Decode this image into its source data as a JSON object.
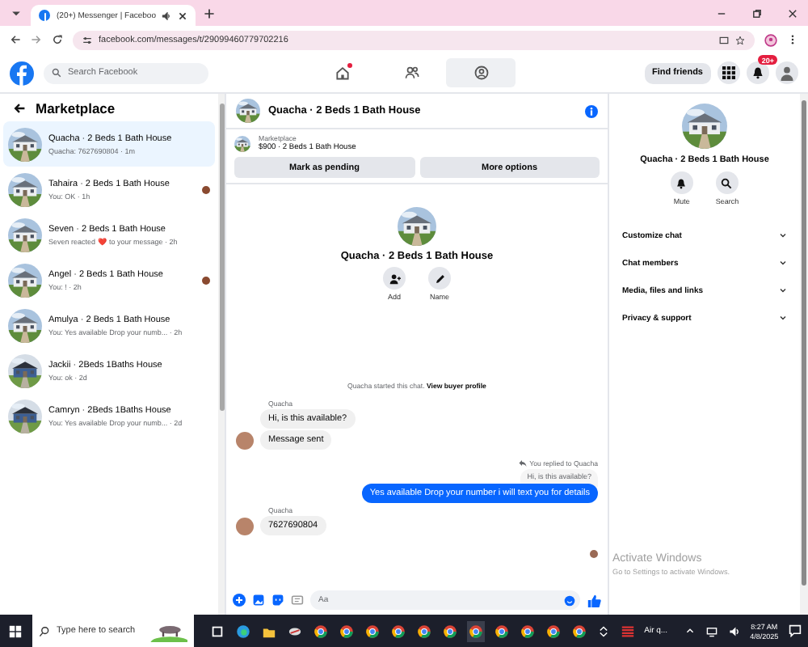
{
  "browser": {
    "tab_title": "(20+) Messenger | Faceboo",
    "url": "facebook.com/messages/t/29099460779702216"
  },
  "header": {
    "search_placeholder": "Search Facebook",
    "nav": [
      {
        "kind": "home",
        "selected": false,
        "notified": true
      },
      {
        "kind": "people",
        "selected": false,
        "notified": false
      },
      {
        "kind": "marketplace",
        "selected": true,
        "notified": false
      }
    ],
    "find_friends": "Find friends",
    "notification_count": "20+"
  },
  "sidebar": {
    "title": "Marketplace",
    "conversations": [
      {
        "name": "Quacha · 2 Beds 1 Bath House",
        "preview": "Quacha: 7627690804 · 1m",
        "selected": true,
        "seen": false,
        "kind": "white_house"
      },
      {
        "name": "Tahaira · 2 Beds 1 Bath House",
        "preview": "You: OK · 1h",
        "selected": false,
        "seen": true,
        "kind": "white_house"
      },
      {
        "name": "Seven · 2 Beds 1 Bath House",
        "preview": "Seven reacted ❤️ to your message · 2h",
        "selected": false,
        "seen": false,
        "kind": "white_house"
      },
      {
        "name": "Angel · 2 Beds 1 Bath House",
        "preview": "You: ! · 2h",
        "selected": false,
        "seen": true,
        "kind": "white_house"
      },
      {
        "name": "Amulya · 2 Beds 1 Bath House",
        "preview": "You: Yes available Drop your numb... · 2h",
        "selected": false,
        "seen": false,
        "kind": "white_house"
      },
      {
        "name": "Jackii · 2Beds 1Baths House",
        "preview": "You: ok · 2d",
        "selected": false,
        "seen": false,
        "kind": "blue_house"
      },
      {
        "name": "Camryn · 2Beds 1Baths House",
        "preview": "You: Yes available Drop your numb... · 2d",
        "selected": false,
        "seen": false,
        "kind": "blue_house"
      }
    ]
  },
  "chat": {
    "title": "Quacha · 2 Beds 1 Bath House",
    "listing": {
      "label": "Marketplace",
      "title": "$900 · 2 Beds 1 Bath House",
      "buttons": [
        "Mark as pending",
        "More options"
      ]
    },
    "intro": {
      "title": "Quacha · 2 Beds 1 Bath House",
      "actions": [
        {
          "kind": "add",
          "label": "Add"
        },
        {
          "kind": "name",
          "label": "Name"
        }
      ]
    },
    "notice": {
      "text": "Quacha started this chat.",
      "link": "View buyer profile"
    },
    "messages": [
      {
        "kind": "sender",
        "text": "Quacha"
      },
      {
        "kind": "in",
        "text": "Hi, is this available?",
        "avatar": false
      },
      {
        "kind": "in",
        "text": "Message sent",
        "avatar": true
      },
      {
        "kind": "reply_note",
        "text": "You replied to Quacha"
      },
      {
        "kind": "quote",
        "text": "Hi, is this available?"
      },
      {
        "kind": "out",
        "text": "Yes available Drop your number i will text you for details"
      },
      {
        "kind": "sender",
        "text": "Quacha"
      },
      {
        "kind": "in",
        "text": "7627690804",
        "avatar": true
      },
      {
        "kind": "read_receipt"
      }
    ],
    "composer": {
      "placeholder": "Aa"
    }
  },
  "details": {
    "title": "Quacha · 2 Beds 1 Bath House",
    "actions": [
      {
        "kind": "mute",
        "label": "Mute"
      },
      {
        "kind": "search",
        "label": "Search"
      }
    ],
    "sections": [
      "Customize chat",
      "Chat members",
      "Media, files and links",
      "Privacy & support"
    ]
  },
  "activation": {
    "title": "Activate Windows",
    "subtitle": "Go to Settings to activate Windows."
  },
  "taskbar": {
    "search_placeholder": "Type here to search",
    "weather": "Air q...",
    "time": "8:27 AM",
    "date": "4/8/2025"
  }
}
